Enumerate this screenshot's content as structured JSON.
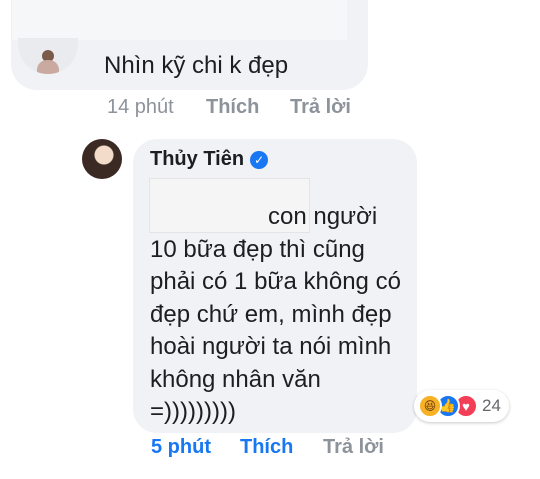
{
  "comment1": {
    "text": "Nhìn kỹ chi k đẹp",
    "time": "14 phút",
    "like_label": "Thích",
    "reply_label": "Trả lời"
  },
  "comment2": {
    "author": "Thủy Tiên",
    "verified_icon": "verified-badge-icon",
    "lines": [
      "con người",
      "10 bữa đẹp thì cũng",
      "phải có 1 bữa không có",
      "đẹp chứ em, mình đẹp",
      "hoài người ta nói mình",
      "không nhân văn",
      "=)))))))))"
    ],
    "reactions": {
      "icons": [
        "haha-icon",
        "like-icon",
        "love-icon"
      ],
      "count": "24"
    },
    "time": "5 phút",
    "like_label": "Thích",
    "reply_label": "Trả lời"
  },
  "colors": {
    "bubble": "#f0f2f5",
    "meta": "#8d939b",
    "accent": "#1877f2"
  }
}
